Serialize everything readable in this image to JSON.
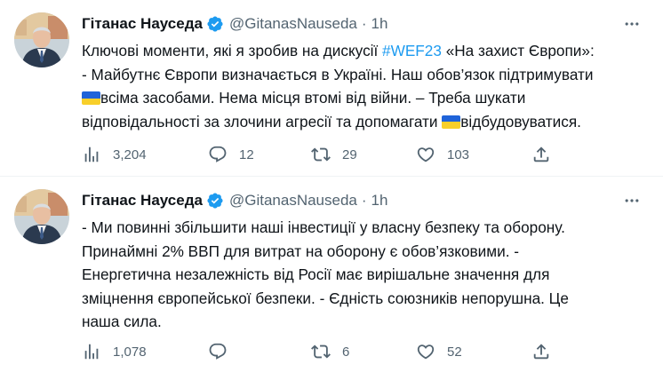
{
  "tweets": [
    {
      "author_name": "Гітанас Науседа",
      "handle": "@GitanasNauseda",
      "separator": "·",
      "time": "1h",
      "lines": [
        {
          "pre": "Ключові моменти, які я зробив на дискусії ",
          "hashtag": "#WEF23",
          "post": " «На захист Європи»:"
        },
        {
          "text": "- Майбутнє Європи визначається в Україні. Наш обов’язок підтримувати"
        },
        {
          "text": "всіма засобами. Нема місця втомі від війни. – Треба шукати"
        },
        {
          "text": "відповідальності за злочини агресії та допомагати "
        },
        {
          "text": "відбудовуватися."
        }
      ],
      "stats": {
        "views": "3,204",
        "replies": "12",
        "retweets": "29",
        "likes": "103"
      }
    },
    {
      "author_name": "Гітанас Науседа",
      "handle": "@GitanasNauseda",
      "separator": "·",
      "time": "1h",
      "lines": [
        {
          "text": "- Ми повинні збільшити наші інвестиції у власну безпеку та оборону."
        },
        {
          "text": "Принаймні 2% ВВП для витрат на оборону є обов’язковими. -"
        },
        {
          "text": "Енергетична незалежність від Росії має вирішальне значення для"
        },
        {
          "text": "зміцнення європейської безпеки. - Єдність союзників непорушна. Це"
        },
        {
          "text": "наша сила."
        }
      ],
      "stats": {
        "views": "1,078",
        "replies": "",
        "retweets": "6",
        "likes": "52"
      }
    }
  ],
  "icons": {
    "verified": "verified-badge-icon",
    "more": "more-horizontal-icon",
    "views": "bar-chart-icon",
    "reply": "chat-bubble-icon",
    "retweet": "retweet-arrows-icon",
    "like": "heart-icon",
    "share": "share-upload-icon",
    "flag": "ukraine-flag-emoji"
  },
  "colors": {
    "accent": "#1d9bf0",
    "text": "#0f1419",
    "muted": "#536471",
    "flag_blue": "#1f63d9",
    "flag_yellow": "#f8cf2a"
  }
}
